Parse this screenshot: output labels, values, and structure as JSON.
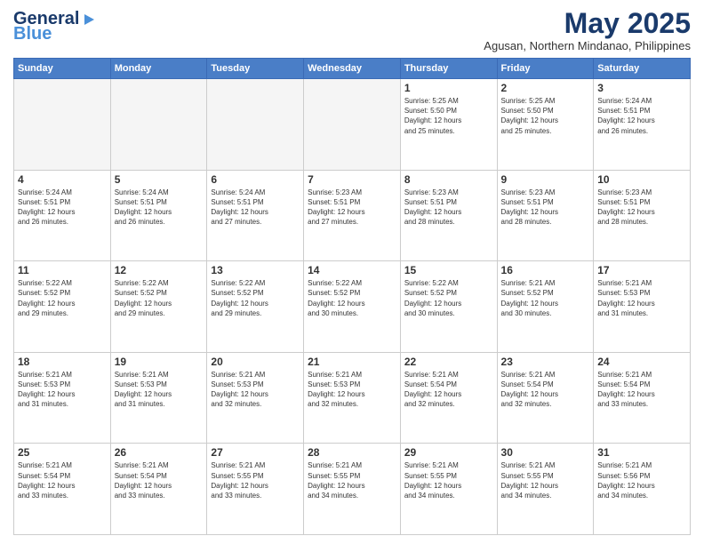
{
  "logo": {
    "line1": "General",
    "line2": "Blue",
    "icon": "▶"
  },
  "header": {
    "month": "May 2025",
    "location": "Agusan, Northern Mindanao, Philippines"
  },
  "weekdays": [
    "Sunday",
    "Monday",
    "Tuesday",
    "Wednesday",
    "Thursday",
    "Friday",
    "Saturday"
  ],
  "weeks": [
    [
      {
        "day": "",
        "info": ""
      },
      {
        "day": "",
        "info": ""
      },
      {
        "day": "",
        "info": ""
      },
      {
        "day": "",
        "info": ""
      },
      {
        "day": "1",
        "info": "Sunrise: 5:25 AM\nSunset: 5:50 PM\nDaylight: 12 hours\nand 25 minutes."
      },
      {
        "day": "2",
        "info": "Sunrise: 5:25 AM\nSunset: 5:50 PM\nDaylight: 12 hours\nand 25 minutes."
      },
      {
        "day": "3",
        "info": "Sunrise: 5:24 AM\nSunset: 5:51 PM\nDaylight: 12 hours\nand 26 minutes."
      }
    ],
    [
      {
        "day": "4",
        "info": "Sunrise: 5:24 AM\nSunset: 5:51 PM\nDaylight: 12 hours\nand 26 minutes."
      },
      {
        "day": "5",
        "info": "Sunrise: 5:24 AM\nSunset: 5:51 PM\nDaylight: 12 hours\nand 26 minutes."
      },
      {
        "day": "6",
        "info": "Sunrise: 5:24 AM\nSunset: 5:51 PM\nDaylight: 12 hours\nand 27 minutes."
      },
      {
        "day": "7",
        "info": "Sunrise: 5:23 AM\nSunset: 5:51 PM\nDaylight: 12 hours\nand 27 minutes."
      },
      {
        "day": "8",
        "info": "Sunrise: 5:23 AM\nSunset: 5:51 PM\nDaylight: 12 hours\nand 28 minutes."
      },
      {
        "day": "9",
        "info": "Sunrise: 5:23 AM\nSunset: 5:51 PM\nDaylight: 12 hours\nand 28 minutes."
      },
      {
        "day": "10",
        "info": "Sunrise: 5:23 AM\nSunset: 5:51 PM\nDaylight: 12 hours\nand 28 minutes."
      }
    ],
    [
      {
        "day": "11",
        "info": "Sunrise: 5:22 AM\nSunset: 5:52 PM\nDaylight: 12 hours\nand 29 minutes."
      },
      {
        "day": "12",
        "info": "Sunrise: 5:22 AM\nSunset: 5:52 PM\nDaylight: 12 hours\nand 29 minutes."
      },
      {
        "day": "13",
        "info": "Sunrise: 5:22 AM\nSunset: 5:52 PM\nDaylight: 12 hours\nand 29 minutes."
      },
      {
        "day": "14",
        "info": "Sunrise: 5:22 AM\nSunset: 5:52 PM\nDaylight: 12 hours\nand 30 minutes."
      },
      {
        "day": "15",
        "info": "Sunrise: 5:22 AM\nSunset: 5:52 PM\nDaylight: 12 hours\nand 30 minutes."
      },
      {
        "day": "16",
        "info": "Sunrise: 5:21 AM\nSunset: 5:52 PM\nDaylight: 12 hours\nand 30 minutes."
      },
      {
        "day": "17",
        "info": "Sunrise: 5:21 AM\nSunset: 5:53 PM\nDaylight: 12 hours\nand 31 minutes."
      }
    ],
    [
      {
        "day": "18",
        "info": "Sunrise: 5:21 AM\nSunset: 5:53 PM\nDaylight: 12 hours\nand 31 minutes."
      },
      {
        "day": "19",
        "info": "Sunrise: 5:21 AM\nSunset: 5:53 PM\nDaylight: 12 hours\nand 31 minutes."
      },
      {
        "day": "20",
        "info": "Sunrise: 5:21 AM\nSunset: 5:53 PM\nDaylight: 12 hours\nand 32 minutes."
      },
      {
        "day": "21",
        "info": "Sunrise: 5:21 AM\nSunset: 5:53 PM\nDaylight: 12 hours\nand 32 minutes."
      },
      {
        "day": "22",
        "info": "Sunrise: 5:21 AM\nSunset: 5:54 PM\nDaylight: 12 hours\nand 32 minutes."
      },
      {
        "day": "23",
        "info": "Sunrise: 5:21 AM\nSunset: 5:54 PM\nDaylight: 12 hours\nand 32 minutes."
      },
      {
        "day": "24",
        "info": "Sunrise: 5:21 AM\nSunset: 5:54 PM\nDaylight: 12 hours\nand 33 minutes."
      }
    ],
    [
      {
        "day": "25",
        "info": "Sunrise: 5:21 AM\nSunset: 5:54 PM\nDaylight: 12 hours\nand 33 minutes."
      },
      {
        "day": "26",
        "info": "Sunrise: 5:21 AM\nSunset: 5:54 PM\nDaylight: 12 hours\nand 33 minutes."
      },
      {
        "day": "27",
        "info": "Sunrise: 5:21 AM\nSunset: 5:55 PM\nDaylight: 12 hours\nand 33 minutes."
      },
      {
        "day": "28",
        "info": "Sunrise: 5:21 AM\nSunset: 5:55 PM\nDaylight: 12 hours\nand 34 minutes."
      },
      {
        "day": "29",
        "info": "Sunrise: 5:21 AM\nSunset: 5:55 PM\nDaylight: 12 hours\nand 34 minutes."
      },
      {
        "day": "30",
        "info": "Sunrise: 5:21 AM\nSunset: 5:55 PM\nDaylight: 12 hours\nand 34 minutes."
      },
      {
        "day": "31",
        "info": "Sunrise: 5:21 AM\nSunset: 5:56 PM\nDaylight: 12 hours\nand 34 minutes."
      }
    ]
  ]
}
